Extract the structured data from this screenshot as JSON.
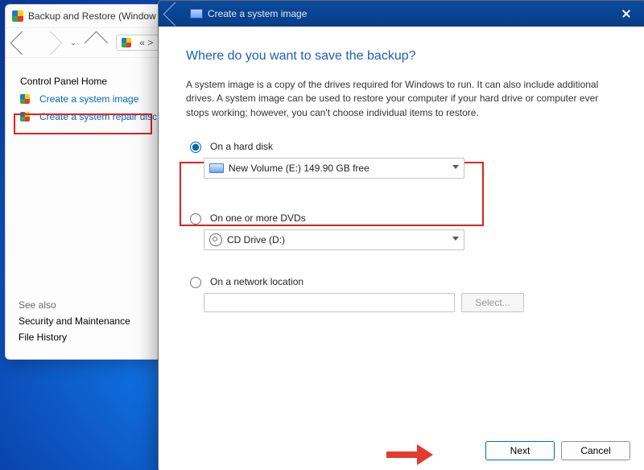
{
  "bgwin": {
    "title": "Backup and Restore (Window",
    "links": {
      "home": "Control Panel Home",
      "create_image": "Create a system image",
      "create_repair": "Create a system repair disc"
    },
    "seealso": {
      "header": "See also",
      "sec": "Security and Maintenance",
      "filehist": "File History"
    }
  },
  "dlg": {
    "title": "Create a system image",
    "heading": "Where do you want to save the backup?",
    "description": "A system image is a copy of the drives required for Windows to run. It can also include additional drives. A system image can be used to restore your computer if your hard drive or computer ever stops working; however, you can't choose individual items to restore.",
    "opt_harddisk": "On a hard disk",
    "harddisk_value": "New Volume (E:)  149.90 GB free",
    "opt_dvd": "On one or more DVDs",
    "dvd_value": "CD Drive (D:)",
    "opt_network": "On a network location",
    "select_btn": "Select...",
    "next": "Next",
    "cancel": "Cancel"
  }
}
